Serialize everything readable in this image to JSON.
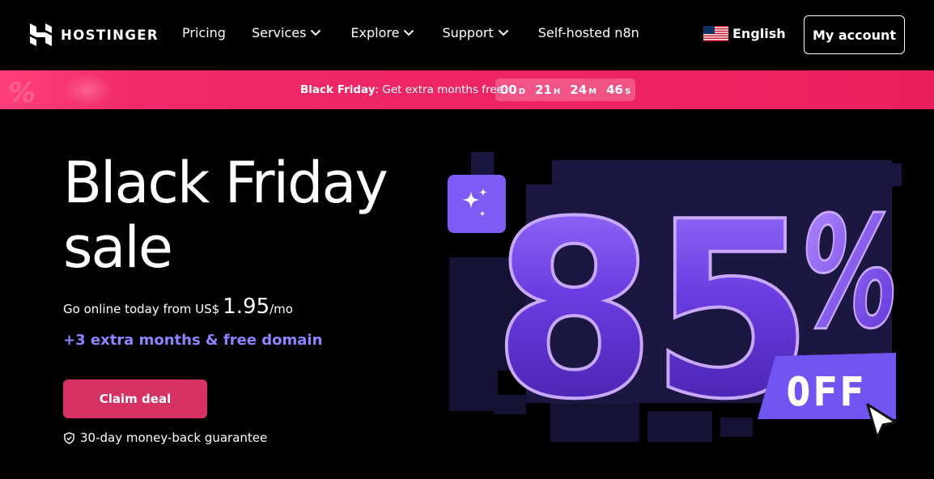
{
  "header": {
    "logo_text": "HOSTINGER",
    "nav": [
      {
        "label": "Pricing",
        "has_dropdown": false
      },
      {
        "label": "Services",
        "has_dropdown": true
      },
      {
        "label": "Explore",
        "has_dropdown": true
      },
      {
        "label": "Support",
        "has_dropdown": true
      },
      {
        "label": "Self-hosted n8n",
        "has_dropdown": false
      }
    ],
    "language": {
      "label": "English",
      "flag_icon": "us-flag-icon"
    },
    "account_label": "My account"
  },
  "banner": {
    "bold": "Black Friday",
    "text": ": Get extra months free",
    "countdown": [
      {
        "value": "00",
        "unit": "D"
      },
      {
        "value": "21",
        "unit": "H"
      },
      {
        "value": "24",
        "unit": "M"
      },
      {
        "value": "46",
        "unit": "S"
      }
    ]
  },
  "hero": {
    "title_line1": "Black Friday",
    "title_line2": "sale",
    "subtitle_prefix": "Go online today from US$",
    "price": "1.95",
    "period": "/mo",
    "extra": "+3 extra months & free domain",
    "cta": "Claim deal",
    "guarantee": "30-day money-back guarantee"
  },
  "art": {
    "discount": "85",
    "percent": "%",
    "off_label": "OFF",
    "icons": [
      "sparkles-icon",
      "cursor-arrow-icon"
    ]
  },
  "colors": {
    "background": "#000000",
    "banner": "#ea1f5e",
    "accent_purple": "#8c85ff",
    "cta": "#d63163",
    "art_purple": "#7b5cf6"
  }
}
